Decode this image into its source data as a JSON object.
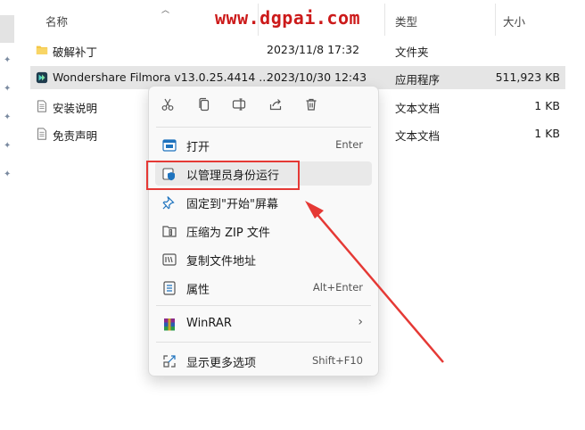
{
  "watermark": "www.dgpai.com",
  "columns": {
    "name": "名称",
    "modified": "",
    "type": "类型",
    "size": "大小"
  },
  "files": [
    {
      "name": "破解补丁",
      "modified": "2023/11/8 17:32",
      "type": "文件夹",
      "size": ""
    },
    {
      "name": "Wondershare Filmora v13.0.25.4414 ...",
      "modified": "2023/10/30 12:43",
      "type": "应用程序",
      "size": "511,923 KB"
    },
    {
      "name": "安装说明",
      "modified": "",
      "type": "文本文档",
      "size": "1 KB"
    },
    {
      "name": "免责声明",
      "modified": "",
      "type": "文本文档",
      "size": "1 KB"
    }
  ],
  "context_menu": {
    "toolbar": [
      "cut-icon",
      "copy-icon",
      "rename-icon",
      "share-icon",
      "delete-icon"
    ],
    "items": [
      {
        "label": "打开",
        "shortcut": "Enter"
      },
      {
        "label": "以管理员身份运行",
        "shortcut": ""
      },
      {
        "label": "固定到\"开始\"屏幕",
        "shortcut": ""
      },
      {
        "label": "压缩为 ZIP 文件",
        "shortcut": ""
      },
      {
        "label": "复制文件地址",
        "shortcut": ""
      },
      {
        "label": "属性",
        "shortcut": "Alt+Enter"
      },
      {
        "label": "WinRAR",
        "shortcut": ""
      },
      {
        "label": "显示更多选项",
        "shortcut": "Shift+F10"
      }
    ]
  },
  "colors": {
    "highlight": "#e53935",
    "folder": "#f4c542",
    "selection": "#e5e5e5"
  }
}
